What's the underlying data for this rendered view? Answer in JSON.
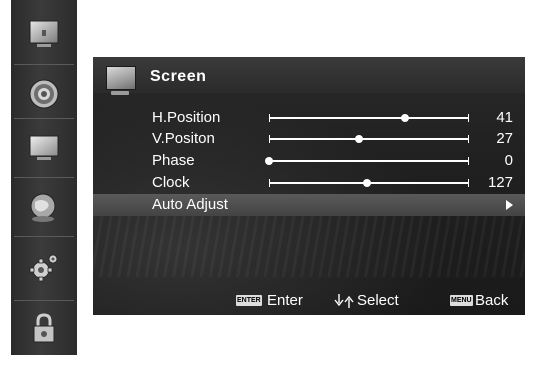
{
  "sidebar": {
    "items": [
      {
        "icon": "picture-icon"
      },
      {
        "icon": "sound-icon"
      },
      {
        "icon": "screen-icon"
      },
      {
        "icon": "channel-globe-icon"
      },
      {
        "icon": "settings-gears-icon"
      },
      {
        "icon": "lock-icon"
      }
    ]
  },
  "header": {
    "title": "Screen",
    "icon": "screen-icon"
  },
  "rows": [
    {
      "label": "H.Position",
      "value": "41",
      "slider": 0.68
    },
    {
      "label": "V.Positon",
      "value": "27",
      "slider": 0.45
    },
    {
      "label": "Phase",
      "value": "0",
      "slider": 0.0
    },
    {
      "label": "Clock",
      "value": "127",
      "slider": 0.49
    },
    {
      "label": "Auto Adjust",
      "selected": true,
      "arrow": "right-arrow-icon"
    }
  ],
  "footer": {
    "enter_key": "ENTER",
    "enter_label": "Enter",
    "select_icon": "up-down-arrows-icon",
    "select_label": "Select",
    "menu_key": "MENU",
    "back_label": "Back"
  },
  "colors": {
    "panel_bg": "#1f1f1f",
    "selected_row": "#505050",
    "text": "#ffffff"
  }
}
